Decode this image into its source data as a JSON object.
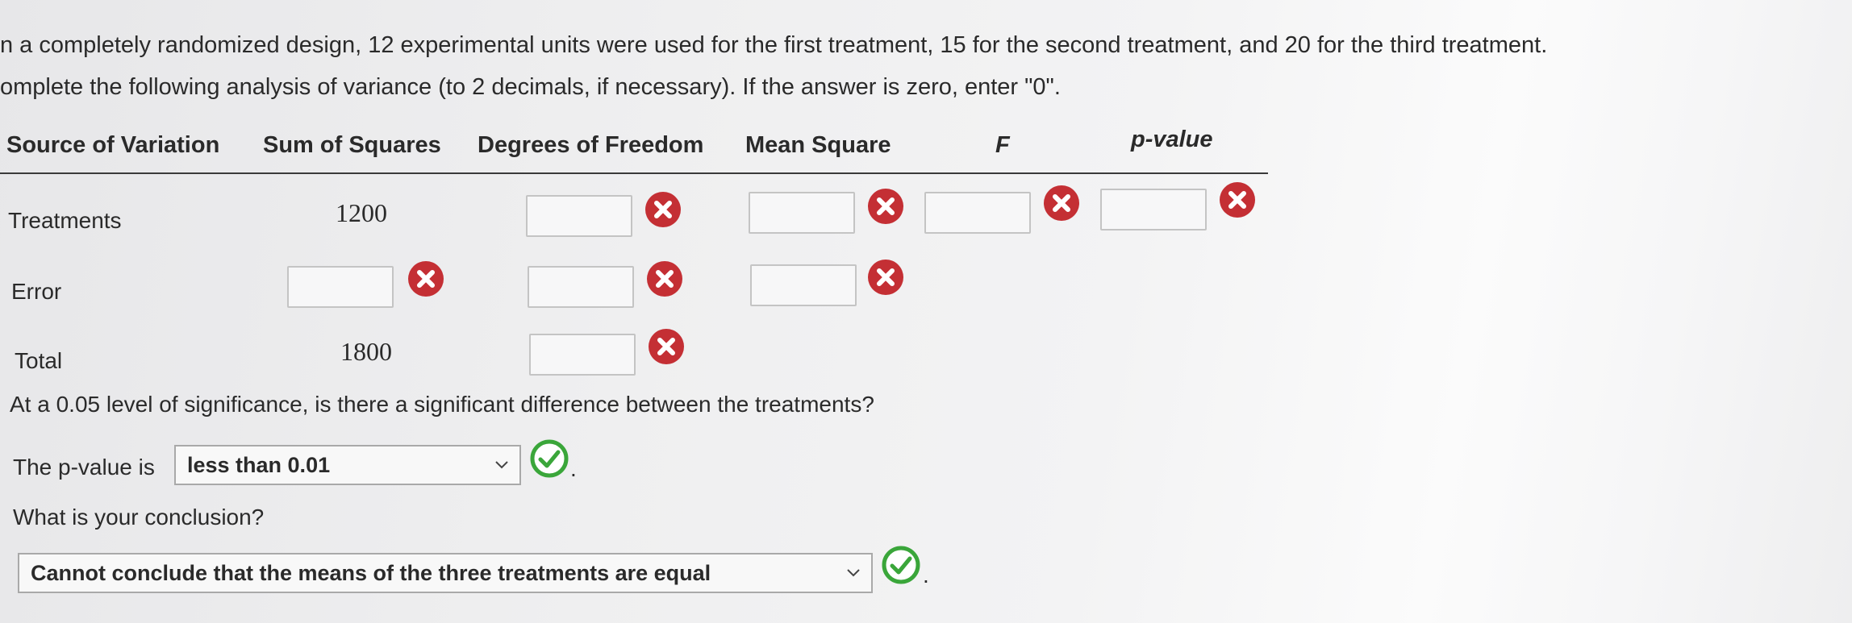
{
  "question": {
    "line1": "n a completely randomized design, 12 experimental units were used for the first treatment, 15 for the second treatment, and 20 for the third treatment.",
    "line2": "omplete the following analysis of variance (to 2 decimals, if necessary). If the answer is zero, enter \"0\"."
  },
  "table": {
    "headers": [
      "Source of Variation",
      "Sum of Squares",
      "Degrees of Freedom",
      "Mean Square",
      "F",
      "p-value"
    ],
    "rows": [
      {
        "label": "Treatments",
        "sum_of_squares": "1200",
        "df": "",
        "mean_square": "",
        "f": "",
        "p_value": ""
      },
      {
        "label": "Error",
        "sum_of_squares": "",
        "df": "",
        "mean_square": ""
      },
      {
        "label": "Total",
        "sum_of_squares": "1800",
        "df": ""
      }
    ]
  },
  "significance": {
    "question": "At a 0.05 level of significance, is there a significant difference between the treatments?",
    "pvalue_prefix": "The p-value is",
    "pvalue_selected": "less than 0.01",
    "conclusion_prompt": "What is your conclusion?",
    "conclusion_selected": "Cannot conclude that the means of the three treatments are equal",
    "period": "."
  },
  "icons": {
    "incorrect": "x-circle-icon",
    "correct": "check-circle-icon",
    "dropdown": "chevron-down-icon"
  },
  "colors": {
    "incorrect_red": "#c42f34",
    "correct_green": "#3aa63a"
  }
}
